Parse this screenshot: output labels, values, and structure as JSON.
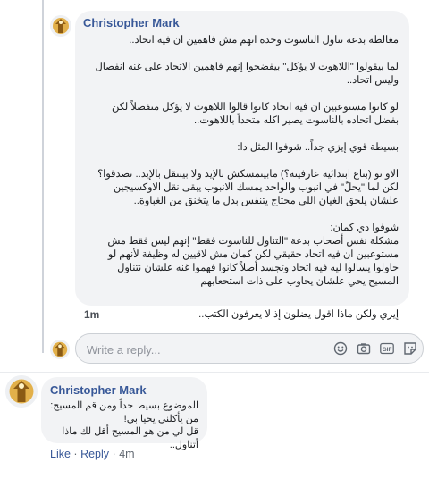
{
  "comment": {
    "author": "Christopher Mark",
    "paragraphs": [
      "مغالطة بدعة تناول الناسوت وحده انهم مش فاهمين ان فيه اتحاد..",
      "لما بيقولوا \"اللاهوت لا يؤكل\" بيفضحوا إنهم فاهمين الاتحاد على غنه انفصال وليس اتحاد..",
      "لو كانوا مستوعبين ان فيه اتحاد كانوا قالوا اللاهوت لا يؤكل منفصلاً لكن بفضل اتحاده بالناسوت يصير اكله متحداً باللاهوت..",
      "بسيطة قوي إيزي جداً.. شوفوا المثل دا:",
      "الاو تو (بتاع ابتدائية عارفينه؟) مابيتمسكش بالإيد ولا بيتنقل بالإيد.. تصدقوا؟ لكن لما \"يحلّ\" في انبوب والواحد يمسك الانبوب يبقى نقل الاوكسيجين علشان يلحق الغيان اللي محتاج يتنفس بدل ما يتخنق من الغباوة..",
      "شوفوا دي كمان:\nمشكلة نفس أصحاب بدعة \"التناول للناسوت فقط\" إنهم ليس فقط مش مستوعبين ان فيه اتحاد حقيقي لكن كمان مش لاقيين له وظيفة لأنهم لو حاولوا يسالوا ليه فيه اتحاد وتجسد أصلاً كانوا فهموا غنه علشان نتناول المسيح يحي علشان يجاوب على ذات استحعابهم",
      "إيزي ولكن ماذا اقول يضلون إذ لا يعرفون الكتب.."
    ],
    "time": "1m"
  },
  "reply_input": {
    "placeholder": "Write a reply...",
    "icons": [
      "smiley-icon",
      "camera-icon",
      "gif-icon",
      "sticker-icon"
    ]
  },
  "reply": {
    "author": "Christopher Mark",
    "paragraphs": [
      "الموضوع بسيط جداً ومن قم المسيح:\nمن يأكلني يحيا بي!\nقل لي من هو المسيح أقل لك ماذا أتناول.."
    ],
    "like_label": "Like",
    "reply_label": "Reply",
    "separator": "·",
    "time": "4m"
  }
}
